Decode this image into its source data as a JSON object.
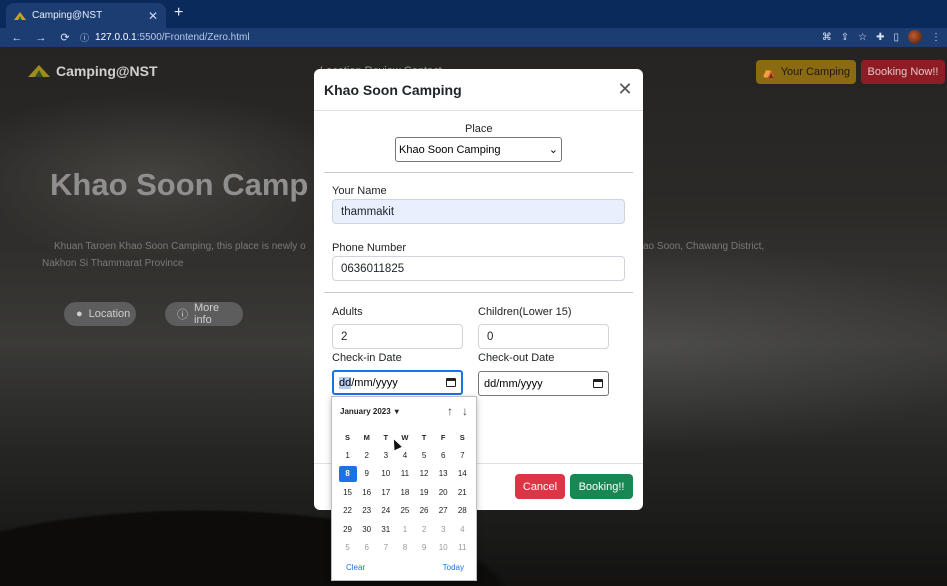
{
  "browser": {
    "tab_title": "Camping@NST",
    "tab_close": "✕",
    "new_tab": "+",
    "url_host": "127.0.0.1",
    "url_path": ":5500/Frontend/Zero.html",
    "nav_back": "←",
    "nav_forward": "→",
    "nav_reload": "⟳"
  },
  "site": {
    "brand": "Camping@NST",
    "your_camping": "Your Camping",
    "booking_now": "Booking Now!!",
    "nav_partial": "Location     Review     Contact",
    "hero_title": "Khao Soon Camp",
    "hero_desc_left": "Khuan Taroen Khao Soon Camping, this place is newly o",
    "hero_desc_right": "ao Soon, Chawang District,",
    "hero_desc_line2": "Nakhon Si Thammarat Province",
    "location_btn": "Location",
    "more_info_btn": "More info"
  },
  "modal": {
    "title": "Khao Soon Camping",
    "close": "✕",
    "place_label": "Place",
    "place_value": "Khao Soon Camping",
    "name_label": "Your Name",
    "name_value": "thammakit",
    "phone_label": "Phone Number",
    "phone_value": "0636011825",
    "adults_label": "Adults",
    "adults_value": "2",
    "children_label": "Children(Lower 15)",
    "children_value": "0",
    "checkin_label": "Check-in Date",
    "checkin_dd": "dd",
    "checkin_rest": "/mm/yyyy",
    "checkout_label": "Check-out Date",
    "checkout_value": "dd/mm/yyyy",
    "cancel": "Cancel",
    "booking": "Booking!!"
  },
  "datepicker": {
    "month": "January 2023",
    "weekdays": [
      "S",
      "M",
      "T",
      "W",
      "T",
      "F",
      "S"
    ],
    "weeks": [
      [
        "1",
        "2",
        "3",
        "4",
        "5",
        "6",
        "7"
      ],
      [
        "8",
        "9",
        "10",
        "11",
        "12",
        "13",
        "14"
      ],
      [
        "15",
        "16",
        "17",
        "18",
        "19",
        "20",
        "21"
      ],
      [
        "22",
        "23",
        "24",
        "25",
        "26",
        "27",
        "28"
      ],
      [
        "29",
        "30",
        "31",
        "1",
        "2",
        "3",
        "4"
      ],
      [
        "5",
        "6",
        "7",
        "8",
        "9",
        "10",
        "11"
      ]
    ],
    "selected": "8",
    "clear": "Clear",
    "today": "Today"
  },
  "colors": {
    "primary": "#1a73e8",
    "cancel": "#dc3545",
    "booking": "#198754",
    "your_camping": "#ffc107",
    "booking_now": "#dc3545"
  }
}
